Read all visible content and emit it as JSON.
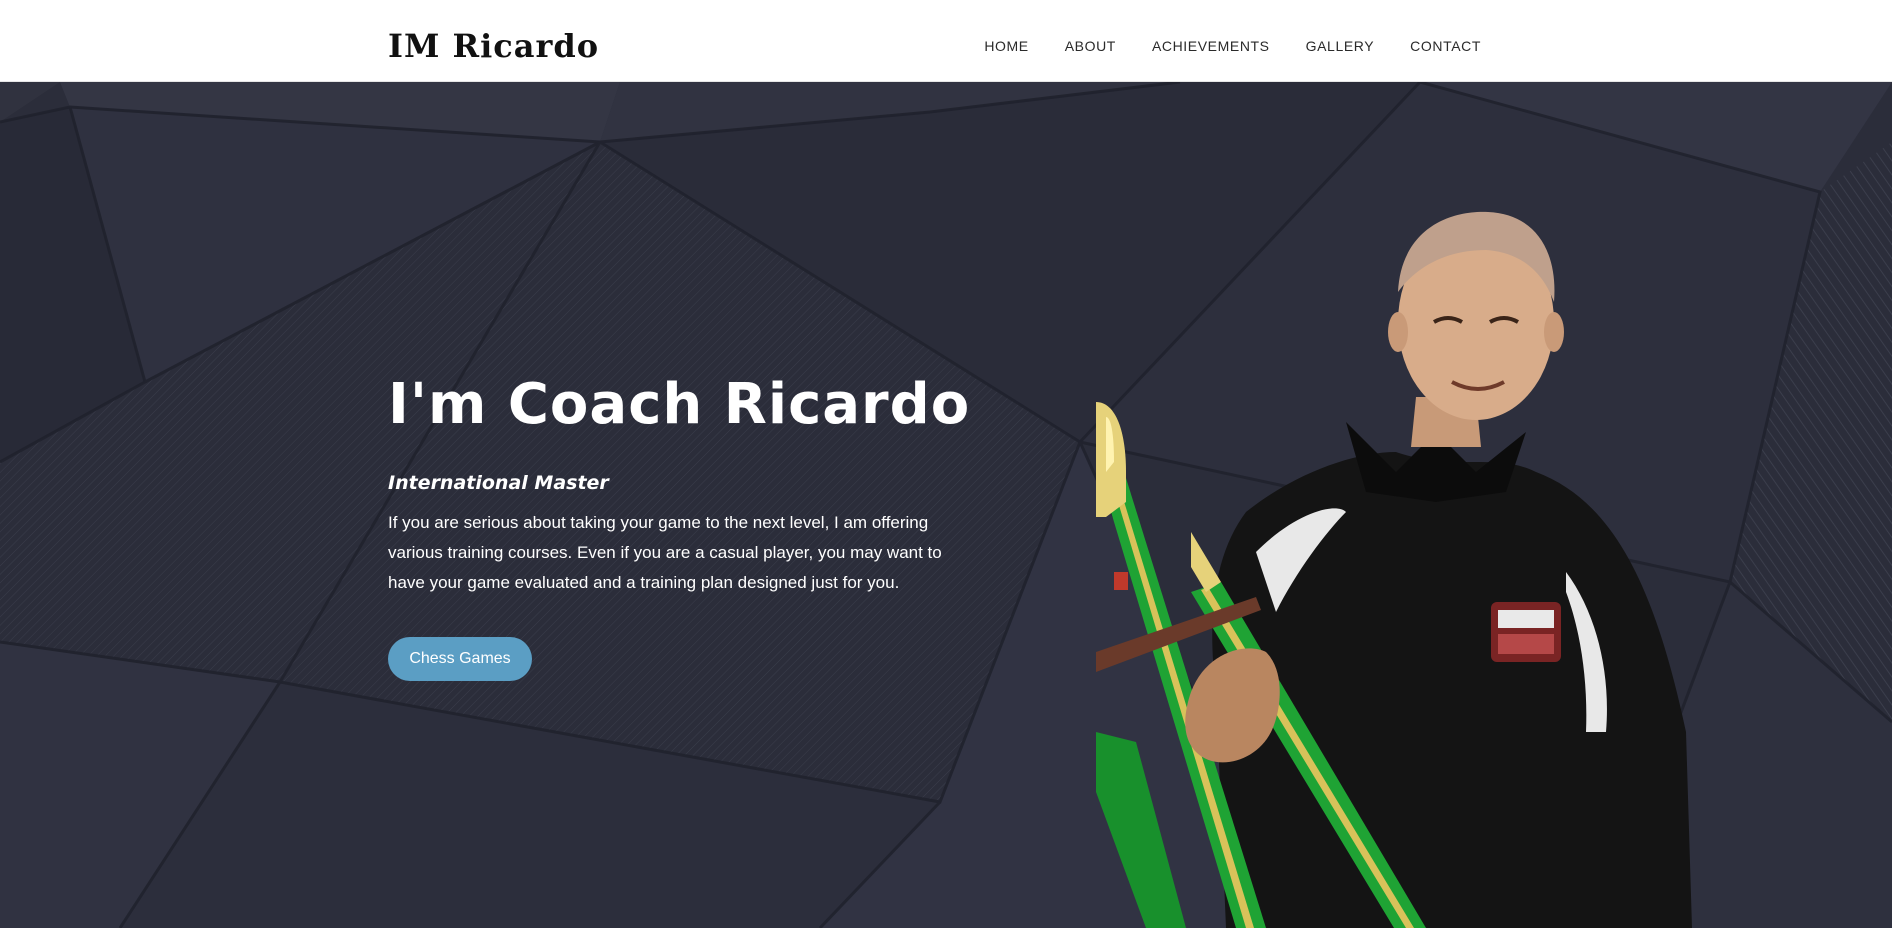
{
  "site": {
    "logo": "IM Ricardo"
  },
  "nav": {
    "items": [
      {
        "label": "HOME"
      },
      {
        "label": "ABOUT"
      },
      {
        "label": "ACHIEVEMENTS"
      },
      {
        "label": "GALLERY"
      },
      {
        "label": "CONTACT"
      }
    ]
  },
  "hero": {
    "title": "I'm Coach Ricardo",
    "subtitle": "International Master",
    "description": "If you are serious about taking your game to the next level, I am offering various training courses. Even if you are a casual player, you may want to have your game evaluated and a training plan designed just for you.",
    "button_label": "Chess Games"
  },
  "colors": {
    "hero_background": "#2b2d3a",
    "button": "#5b9ec4",
    "header_background": "#ffffff",
    "trophy_green": "#1fa334",
    "shirt": "#141414"
  }
}
